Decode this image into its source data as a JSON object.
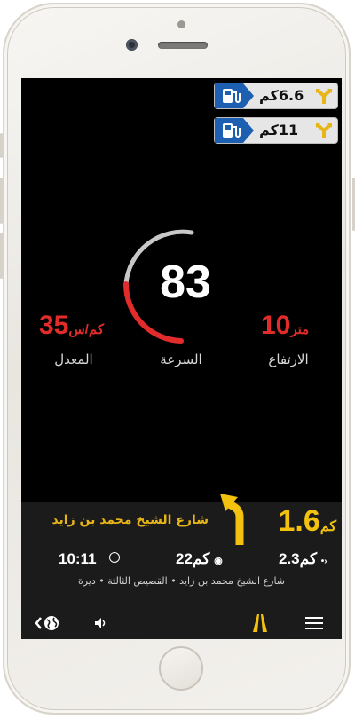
{
  "poi": [
    {
      "distance": "6.6كم",
      "type_icon": "fuel-icon",
      "exit_icon": "exit-icon"
    },
    {
      "distance": "11كم",
      "type_icon": "fuel-icon",
      "exit_icon": "exit-icon"
    }
  ],
  "speedometer": {
    "speed": "83",
    "speed_label": "السرعة",
    "gauge_color": "#c8c8c8",
    "gauge_alert_color": "#e22b2b"
  },
  "average_speed": {
    "value": "35",
    "unit": "كم/س",
    "label": "المعدل"
  },
  "altitude": {
    "value": "10",
    "unit": "متر",
    "label": "الارتفاع"
  },
  "navigation": {
    "street": "شارع الشيخ محمد بن زايد",
    "next_turn_distance": {
      "value": "1.6",
      "unit": "كم"
    },
    "eta": "10:11",
    "remaining_distance": "22كم",
    "remaining_to_waypoint": "2.3كم",
    "route": "شارع الشيخ محمد بن زايد • القصيص الثالثة • ديرة"
  },
  "colors": {
    "accent": "#f2c20f",
    "alert": "#e22b2b",
    "panel": "#1b1b1b",
    "poi_blue": "#1d5fb0"
  }
}
